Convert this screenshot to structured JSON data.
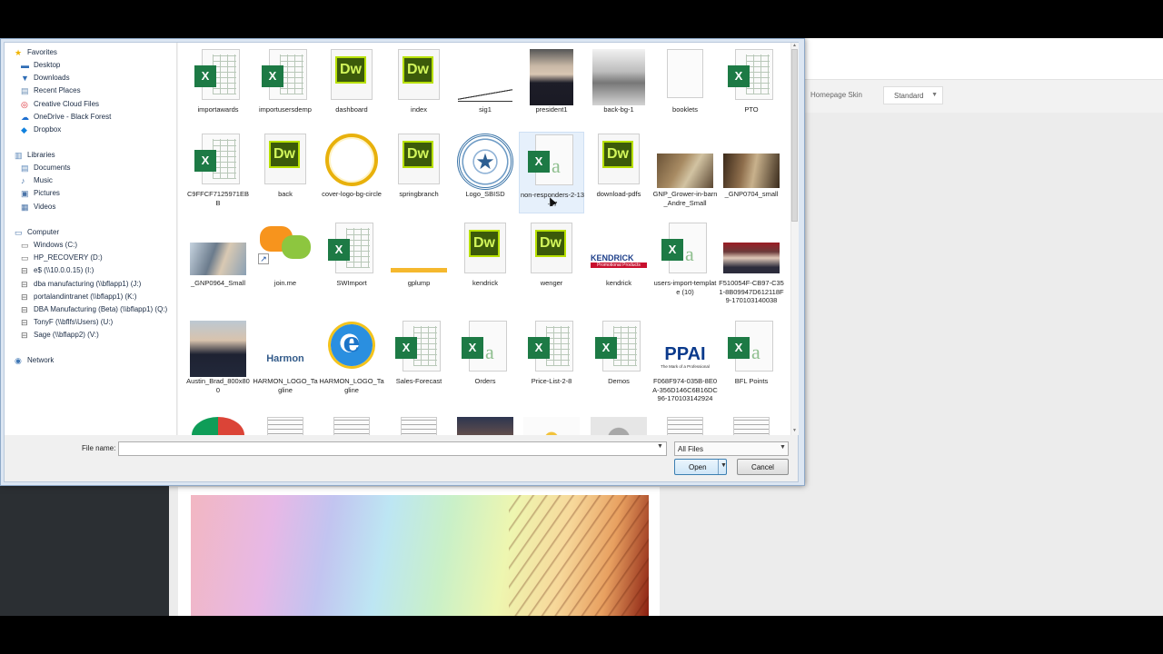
{
  "background_page": {
    "skin_label": "Homepage Skin",
    "skin_value": "Standard"
  },
  "dialog": {
    "nav": {
      "favorites": {
        "header": "Favorites",
        "items": [
          "Desktop",
          "Downloads",
          "Recent Places",
          "Creative Cloud Files",
          "OneDrive - Black Forest",
          "Dropbox"
        ]
      },
      "libraries": {
        "header": "Libraries",
        "items": [
          "Documents",
          "Music",
          "Pictures",
          "Videos"
        ]
      },
      "computer": {
        "header": "Computer",
        "items": [
          "Windows (C:)",
          "HP_RECOVERY (D:)",
          "e$ (\\\\10.0.0.15) (I:)",
          "dba manufacturing (\\\\bflapp1) (J:)",
          "portalandintranet (\\\\bflapp1) (K:)",
          "DBA Manufacturing (Beta) (\\\\bflapp1) (Q:)",
          "TonyF (\\\\bflfs\\Users) (U:)",
          "Sage (\\\\bflapp2) (V:)"
        ]
      },
      "network": {
        "header": "Network"
      }
    },
    "files": [
      {
        "name": "importawards",
        "kind": "excel"
      },
      {
        "name": "importusersdemp",
        "kind": "excel"
      },
      {
        "name": "dashboard",
        "kind": "dreamweaver"
      },
      {
        "name": "index",
        "kind": "dreamweaver"
      },
      {
        "name": "sig1",
        "kind": "signature"
      },
      {
        "name": "president1",
        "kind": "photo"
      },
      {
        "name": "back-bg-1",
        "kind": "photo"
      },
      {
        "name": "booklets",
        "kind": "blank"
      },
      {
        "name": "PTO",
        "kind": "excel"
      },
      {
        "name": "C9FFCF7125971EBB",
        "kind": "excel"
      },
      {
        "name": "back",
        "kind": "dreamweaver"
      },
      {
        "name": "cover-logo-bg-circle",
        "kind": "circle"
      },
      {
        "name": "springbranch",
        "kind": "dreamweaver"
      },
      {
        "name": "Logo_SBISD",
        "kind": "seal"
      },
      {
        "name": "non-responders-2-13-17",
        "kind": "excel-csv"
      },
      {
        "name": "download-pdfs",
        "kind": "dreamweaver"
      },
      {
        "name": "GNP_Grower-in-barn_Andre_Small",
        "kind": "photo"
      },
      {
        "name": "_GNP0704_small",
        "kind": "photo"
      },
      {
        "name": "_GNP0964_Small",
        "kind": "photo"
      },
      {
        "name": "join.me",
        "kind": "joinme"
      },
      {
        "name": "SWImport",
        "kind": "excel"
      },
      {
        "name": "gplump",
        "kind": "bar"
      },
      {
        "name": "kendrick",
        "kind": "dreamweaver"
      },
      {
        "name": "wenger",
        "kind": "dreamweaver"
      },
      {
        "name": "kendrick",
        "kind": "kendrick-logo"
      },
      {
        "name": "users-import-template (10)",
        "kind": "excel-csv"
      },
      {
        "name": "F510054F-CB97-C351-8B09947D612118F9-170103140038",
        "kind": "photo"
      },
      {
        "name": "Austin_Brad_800x800",
        "kind": "photo"
      },
      {
        "name": "HARMON_LOGO_Tagline",
        "kind": "harmon"
      },
      {
        "name": "HARMON_LOGO_Tagline",
        "kind": "ie"
      },
      {
        "name": "Sales-Forecast",
        "kind": "excel"
      },
      {
        "name": "Orders",
        "kind": "excel-csv"
      },
      {
        "name": "Price-List-2-8",
        "kind": "excel"
      },
      {
        "name": "Demos",
        "kind": "excel"
      },
      {
        "name": "F068F974-035B-8E0A-356D146C6B16DC96-170103142924",
        "kind": "ppai"
      },
      {
        "name": "BFL Points",
        "kind": "excel-csv"
      }
    ],
    "logos": {
      "kendrick_text": "KENDRICK",
      "kendrick_sub": "Promotional Products",
      "harmon_text": "Harmon",
      "ppai_text": "PPAI",
      "ppai_sub": "The Mark of a Professional",
      "dw_text": "Dw",
      "xl_text": "X",
      "csv_text": "a"
    },
    "file_name_label": "File name:",
    "file_name_value": "",
    "file_type_value": "All Files",
    "open_label": "Open",
    "cancel_label": "Cancel"
  },
  "colors": {
    "excel_green": "#1d7a45",
    "dw_dark": "#3b5a0a",
    "dw_accent": "#b7e000",
    "nav_text": "#1a2b44"
  }
}
